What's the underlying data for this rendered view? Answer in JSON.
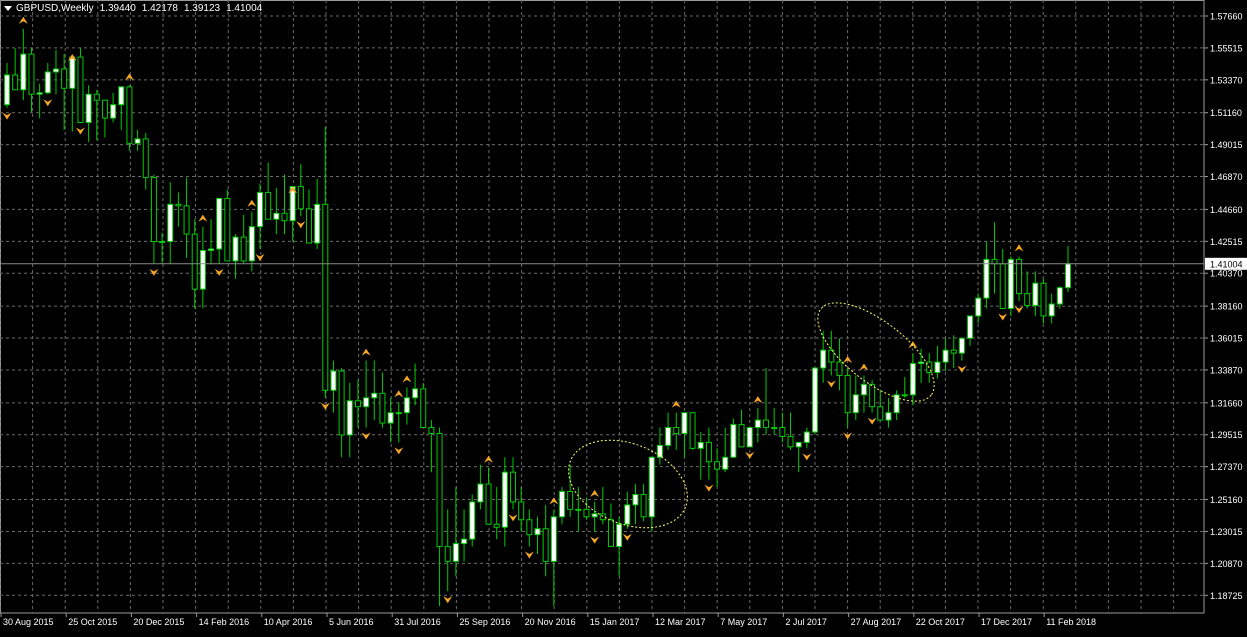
{
  "window": {
    "symbol": "GBPUSD,Weekly",
    "ohlc": [
      "1.39440",
      "1.42178",
      "1.39123",
      "1.41004"
    ]
  },
  "colors": {
    "background": "#000000",
    "bull_candle": "#ffffff",
    "bear_candle": "#000000",
    "candle_wick": "#00cc00",
    "grid": "#6b6b6b",
    "fractal_marker": "#f5a623",
    "ellipse": "#ffff66",
    "current_price_bg": "#ffffff"
  },
  "chart_data": {
    "type": "candlestick",
    "title": "GBPUSD,Weekly",
    "ylim": [
      1.1787,
      1.5766
    ],
    "yticks": [
      "1.57660",
      "1.55515",
      "1.53370",
      "1.51160",
      "1.49015",
      "1.46870",
      "1.44660",
      "1.42515",
      "1.40370",
      "1.38160",
      "1.36015",
      "1.33870",
      "1.31660",
      "1.29515",
      "1.27370",
      "1.25160",
      "1.23015",
      "1.20870",
      "1.18725"
    ],
    "current_price": "1.41004",
    "xticks": [
      "30 Aug 2015",
      "25 Oct 2015",
      "20 Dec 2015",
      "14 Feb 2016",
      "10 Apr 2016",
      "5 Jun 2016",
      "31 Jul 2016",
      "25 Sep 2016",
      "20 Nov 2016",
      "15 Jan 2017",
      "12 Mar 2017",
      "7 May 2017",
      "2 Jul 2017",
      "27 Aug 2017",
      "22 Oct 2017",
      "17 Dec 2017",
      "11 Feb 2018"
    ],
    "candles": [
      [
        1.517,
        1.545,
        1.515,
        1.537
      ],
      [
        1.537,
        1.555,
        1.529,
        1.527
      ],
      [
        1.527,
        1.568,
        1.52,
        1.551
      ],
      [
        1.551,
        1.555,
        1.512,
        1.524
      ],
      [
        1.524,
        1.531,
        1.508,
        1.525
      ],
      [
        1.525,
        1.545,
        1.524,
        1.539
      ],
      [
        1.539,
        1.554,
        1.524,
        1.541
      ],
      [
        1.541,
        1.551,
        1.5,
        1.528
      ],
      [
        1.528,
        1.543,
        1.499,
        1.549
      ],
      [
        1.549,
        1.555,
        1.505,
        1.505
      ],
      [
        1.505,
        1.53,
        1.492,
        1.524
      ],
      [
        1.524,
        1.527,
        1.493,
        1.52
      ],
      [
        1.52,
        1.52,
        1.495,
        1.508
      ],
      [
        1.508,
        1.525,
        1.505,
        1.517
      ],
      [
        1.517,
        1.524,
        1.5,
        1.529
      ],
      [
        1.529,
        1.53,
        1.486,
        1.491
      ],
      [
        1.491,
        1.5,
        1.486,
        1.494
      ],
      [
        1.494,
        1.498,
        1.46,
        1.468
      ],
      [
        1.468,
        1.47,
        1.41,
        1.425
      ],
      [
        1.425,
        1.431,
        1.41,
        1.425
      ],
      [
        1.425,
        1.465,
        1.41,
        1.45
      ],
      [
        1.45,
        1.458,
        1.435,
        1.449
      ],
      [
        1.449,
        1.468,
        1.414,
        1.43
      ],
      [
        1.43,
        1.44,
        1.38,
        1.393
      ],
      [
        1.393,
        1.435,
        1.38,
        1.419
      ],
      [
        1.419,
        1.44,
        1.41,
        1.42
      ],
      [
        1.42,
        1.449,
        1.41,
        1.454
      ],
      [
        1.454,
        1.46,
        1.414,
        1.412
      ],
      [
        1.412,
        1.43,
        1.4,
        1.428
      ],
      [
        1.428,
        1.443,
        1.41,
        1.412
      ],
      [
        1.412,
        1.445,
        1.405,
        1.435
      ],
      [
        1.435,
        1.464,
        1.42,
        1.458
      ],
      [
        1.458,
        1.478,
        1.44,
        1.44
      ],
      [
        1.44,
        1.461,
        1.43,
        1.444
      ],
      [
        1.444,
        1.47,
        1.43,
        1.439
      ],
      [
        1.439,
        1.454,
        1.425,
        1.462
      ],
      [
        1.462,
        1.477,
        1.442,
        1.447
      ],
      [
        1.447,
        1.46,
        1.43,
        1.424
      ],
      [
        1.424,
        1.467,
        1.42,
        1.45
      ],
      [
        1.45,
        1.502,
        1.32,
        1.325
      ],
      [
        1.325,
        1.345,
        1.31,
        1.338
      ],
      [
        1.338,
        1.34,
        1.28,
        1.295
      ],
      [
        1.295,
        1.33,
        1.28,
        1.318
      ],
      [
        1.318,
        1.332,
        1.3,
        1.314
      ],
      [
        1.314,
        1.345,
        1.3,
        1.32
      ],
      [
        1.32,
        1.345,
        1.305,
        1.323
      ],
      [
        1.323,
        1.337,
        1.3,
        1.303
      ],
      [
        1.303,
        1.32,
        1.29,
        1.31
      ],
      [
        1.31,
        1.317,
        1.29,
        1.31
      ],
      [
        1.31,
        1.327,
        1.302,
        1.32
      ],
      [
        1.32,
        1.343,
        1.315,
        1.326
      ],
      [
        1.326,
        1.33,
        1.3,
        1.3
      ],
      [
        1.3,
        1.305,
        1.27,
        1.296
      ],
      [
        1.296,
        1.3,
        1.18,
        1.22
      ],
      [
        1.22,
        1.245,
        1.19,
        1.21
      ],
      [
        1.21,
        1.26,
        1.2,
        1.222
      ],
      [
        1.222,
        1.245,
        1.21,
        1.225
      ],
      [
        1.225,
        1.255,
        1.22,
        1.25
      ],
      [
        1.25,
        1.275,
        1.245,
        1.262
      ],
      [
        1.262,
        1.273,
        1.235,
        1.235
      ],
      [
        1.235,
        1.26,
        1.225,
        1.233
      ],
      [
        1.233,
        1.28,
        1.22,
        1.27
      ],
      [
        1.27,
        1.28,
        1.245,
        1.25
      ],
      [
        1.25,
        1.26,
        1.23,
        1.238
      ],
      [
        1.238,
        1.245,
        1.22,
        1.228
      ],
      [
        1.228,
        1.24,
        1.215,
        1.232
      ],
      [
        1.232,
        1.248,
        1.2,
        1.21
      ],
      [
        1.21,
        1.245,
        1.18,
        1.24
      ],
      [
        1.24,
        1.26,
        1.235,
        1.257
      ],
      [
        1.257,
        1.275,
        1.24,
        1.245
      ],
      [
        1.245,
        1.26,
        1.23,
        1.245
      ],
      [
        1.245,
        1.253,
        1.238,
        1.24
      ],
      [
        1.24,
        1.25,
        1.23,
        1.242
      ],
      [
        1.242,
        1.26,
        1.235,
        1.238
      ],
      [
        1.238,
        1.249,
        1.225,
        1.22
      ],
      [
        1.22,
        1.24,
        1.2,
        1.235
      ],
      [
        1.235,
        1.257,
        1.232,
        1.248
      ],
      [
        1.248,
        1.262,
        1.235,
        1.255
      ],
      [
        1.255,
        1.262,
        1.237,
        1.24
      ],
      [
        1.24,
        1.28,
        1.23,
        1.28
      ],
      [
        1.28,
        1.3,
        1.275,
        1.288
      ],
      [
        1.288,
        1.31,
        1.285,
        1.3
      ],
      [
        1.3,
        1.31,
        1.285,
        1.296
      ],
      [
        1.296,
        1.307,
        1.28,
        1.31
      ],
      [
        1.31,
        1.305,
        1.285,
        1.286
      ],
      [
        1.286,
        1.297,
        1.265,
        1.29
      ],
      [
        1.29,
        1.3,
        1.265,
        1.277
      ],
      [
        1.277,
        1.286,
        1.26,
        1.272
      ],
      [
        1.272,
        1.3,
        1.27,
        1.28
      ],
      [
        1.28,
        1.306,
        1.28,
        1.302
      ],
      [
        1.302,
        1.312,
        1.29,
        1.287
      ],
      [
        1.287,
        1.3,
        1.287,
        1.3
      ],
      [
        1.3,
        1.313,
        1.29,
        1.305
      ],
      [
        1.305,
        1.34,
        1.295,
        1.3
      ],
      [
        1.3,
        1.313,
        1.295,
        1.3
      ],
      [
        1.3,
        1.31,
        1.29,
        1.294
      ],
      [
        1.294,
        1.31,
        1.285,
        1.287
      ],
      [
        1.287,
        1.29,
        1.27,
        1.29
      ],
      [
        1.29,
        1.3,
        1.286,
        1.297
      ],
      [
        1.297,
        1.34,
        1.296,
        1.34
      ],
      [
        1.34,
        1.365,
        1.33,
        1.352
      ],
      [
        1.352,
        1.365,
        1.335,
        1.344
      ],
      [
        1.344,
        1.36,
        1.325,
        1.335
      ],
      [
        1.335,
        1.34,
        1.3,
        1.31
      ],
      [
        1.31,
        1.335,
        1.305,
        1.322
      ],
      [
        1.322,
        1.335,
        1.31,
        1.329
      ],
      [
        1.329,
        1.332,
        1.31,
        1.314
      ],
      [
        1.314,
        1.325,
        1.305,
        1.305
      ],
      [
        1.305,
        1.32,
        1.3,
        1.31
      ],
      [
        1.31,
        1.325,
        1.305,
        1.322
      ],
      [
        1.322,
        1.334,
        1.32,
        1.322
      ],
      [
        1.322,
        1.35,
        1.315,
        1.343
      ],
      [
        1.343,
        1.353,
        1.33,
        1.344
      ],
      [
        1.344,
        1.35,
        1.33,
        1.337
      ],
      [
        1.337,
        1.355,
        1.333,
        1.344
      ],
      [
        1.344,
        1.36,
        1.338,
        1.352
      ],
      [
        1.352,
        1.362,
        1.34,
        1.35
      ],
      [
        1.35,
        1.36,
        1.345,
        1.36
      ],
      [
        1.36,
        1.375,
        1.355,
        1.375
      ],
      [
        1.375,
        1.39,
        1.37,
        1.387
      ],
      [
        1.387,
        1.425,
        1.38,
        1.413
      ],
      [
        1.413,
        1.438,
        1.39,
        1.41
      ],
      [
        1.41,
        1.42,
        1.38,
        1.38
      ],
      [
        1.38,
        1.415,
        1.375,
        1.413
      ],
      [
        1.413,
        1.415,
        1.385,
        1.39
      ],
      [
        1.39,
        1.405,
        1.38,
        1.382
      ],
      [
        1.382,
        1.405,
        1.375,
        1.397
      ],
      [
        1.397,
        1.4,
        1.37,
        1.375
      ],
      [
        1.375,
        1.39,
        1.37,
        1.383
      ],
      [
        1.383,
        1.395,
        1.38,
        1.394
      ],
      [
        1.394,
        1.422,
        1.391,
        1.41
      ]
    ],
    "fractals_up": [
      2,
      8,
      15,
      24,
      30,
      35,
      44,
      48,
      49,
      59,
      67,
      72,
      82,
      92,
      103,
      105,
      111,
      124
    ],
    "fractals_down": [
      0,
      5,
      9,
      18,
      26,
      31,
      36,
      39,
      44,
      48,
      54,
      62,
      64,
      72,
      76,
      86,
      91,
      98,
      101,
      103,
      106,
      117,
      122,
      124
    ]
  }
}
